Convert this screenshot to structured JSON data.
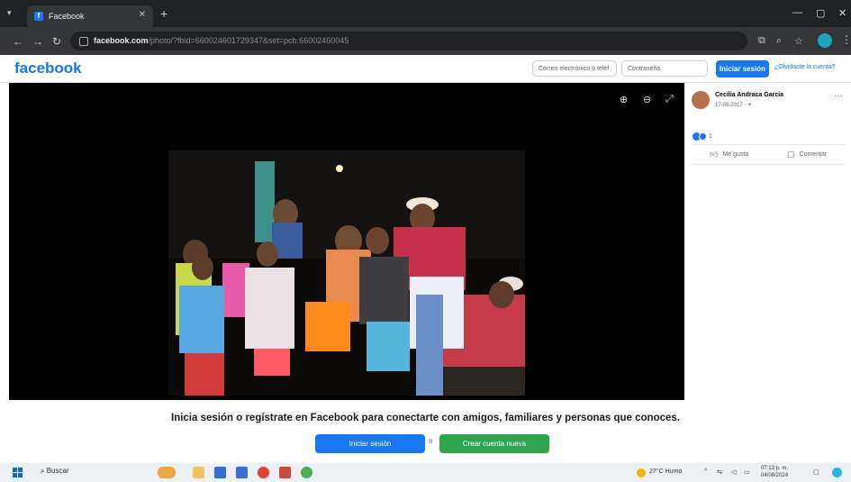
{
  "browser": {
    "tab_title": "Facebook",
    "url_host": "facebook.com",
    "url_path": "/photo/?fbid=660024601729347&set=pcb.66002460045"
  },
  "header": {
    "logo": "facebook",
    "email_placeholder": "Correo electrónico o teléf",
    "password_placeholder": "Contraseña",
    "login_label": "Iniciar sesión",
    "forgot_label": "¿Olvidaste la cuenta?"
  },
  "viewer": {
    "zoom_in_icon": "⊕",
    "zoom_out_icon": "⊖",
    "fullscreen_icon": "⤢"
  },
  "post": {
    "author": "Cecilia Andraca Garcia",
    "date": "17-08-2017 · ✈",
    "reaction_count": "1",
    "like_label": "Me gusta",
    "comment_label": "Comentar"
  },
  "cta": {
    "message": "Inicia sesión o regístrate en Facebook para conectarte con amigos, familiares y personas que conoces.",
    "login_label": "Iniciar sesión",
    "separator": "o",
    "create_label": "Crear cuenta nueva"
  },
  "taskbar": {
    "search_label": "Buscar",
    "weather": "27°C Humo",
    "time": "07:13 p. m.",
    "date": "04/08/2024"
  },
  "colors": {
    "fb_blue": "#1877f2",
    "create_green": "#2ea44f"
  }
}
